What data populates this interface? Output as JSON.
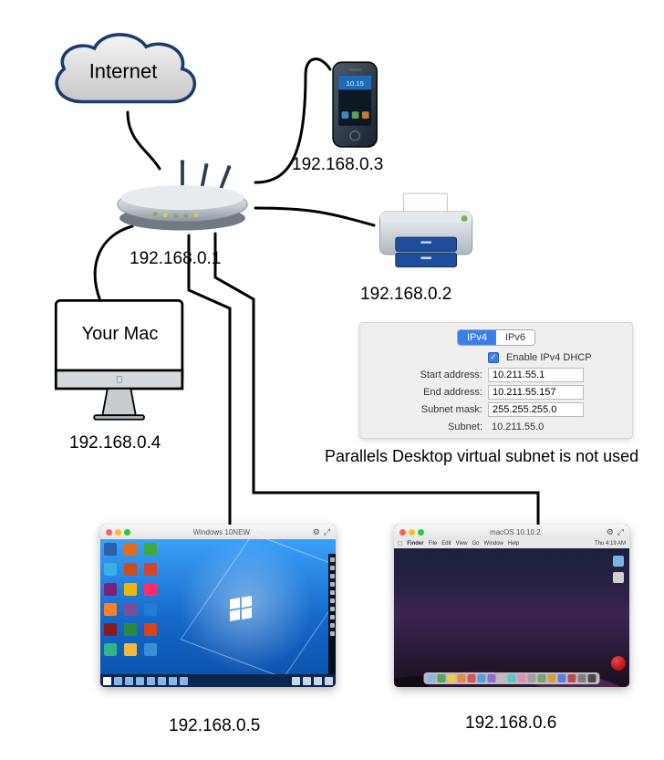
{
  "cloud": {
    "label": "Internet"
  },
  "devices": {
    "router": {
      "ip": "192.168.0.1"
    },
    "printer": {
      "ip": "192.168.0.2"
    },
    "phone": {
      "ip": "192.168.0.3"
    },
    "mac": {
      "ip": "192.168.0.4",
      "label": "Your Mac"
    },
    "vm_win": {
      "ip": "192.168.0.5",
      "title": "Windows 10NEW"
    },
    "vm_mac": {
      "ip": "192.168.0.6",
      "title": "macOS 10.10.2"
    }
  },
  "panel": {
    "tabs": {
      "ipv4": "IPv4",
      "ipv6": "IPv6"
    },
    "dhcp_label": "Enable IPv4 DHCP",
    "rows": {
      "start": {
        "label": "Start address:",
        "value": "10.211.55.1"
      },
      "end": {
        "label": "End address:",
        "value": "10.211.55.157"
      },
      "mask": {
        "label": "Subnet mask:",
        "value": "255.255.255.0"
      },
      "subnet": {
        "label": "Subnet:",
        "value": "10.211.55.0"
      }
    },
    "caption": "Parallels Desktop virtual subnet is not used"
  },
  "phone_time": "10.15",
  "mac_menu": {
    "items": [
      "Finder",
      "File",
      "Edit",
      "View",
      "Go",
      "Window",
      "Help"
    ],
    "clock": "Thu 4:19 AM"
  },
  "dock_colors": [
    "#8fb6e6",
    "#5aa35a",
    "#efc84d",
    "#e58a3f",
    "#d95555",
    "#4ea2d9",
    "#8b6fd1",
    "#bdbdbd",
    "#5ec2c9",
    "#e08fb4",
    "#a0a0a0",
    "#6fa96f",
    "#d3a040",
    "#5e7be0",
    "#b84d4d",
    "#808080",
    "#4b4b4b"
  ],
  "win_icons": [
    "#2c5fae",
    "#e06d1a",
    "#3faa3f",
    "#38b1e6",
    "#cc4d22",
    "#d4442b",
    "#7b2176",
    "#f2b705",
    "#ff2d67",
    "#ff7f27",
    "#7c4d9c",
    "#247bd6",
    "#8c1919",
    "#2a8a3f",
    "#d6441b",
    "#32b58a",
    "#f2b83f",
    "#3790d6"
  ],
  "taskbar_icons": 7,
  "side_dock_icons": 10
}
